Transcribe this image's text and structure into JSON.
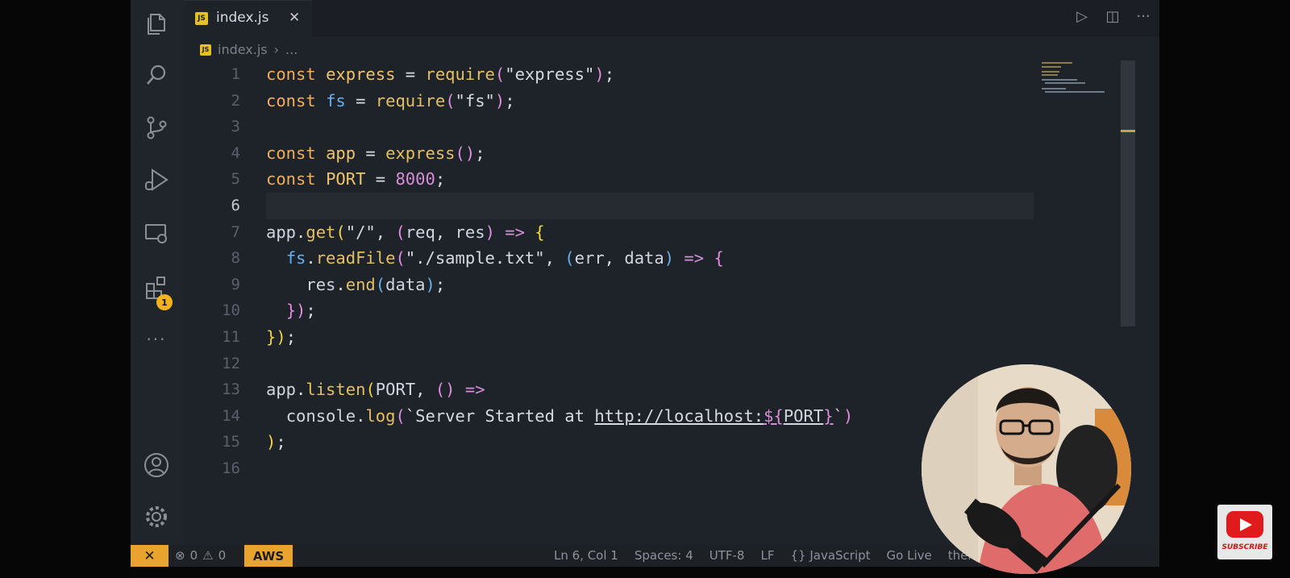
{
  "tab": {
    "icon": "js-file-icon",
    "badge_text": "JS",
    "label": "index.js",
    "close": "✕"
  },
  "breadcrumb": {
    "file": "index.js",
    "sep": "›",
    "more": "..."
  },
  "activity_bar": {
    "items": [
      "explorer-icon",
      "search-icon",
      "source-control-icon",
      "run-debug-icon",
      "remote-explorer-icon",
      "extensions-icon"
    ],
    "extensions_badge": "1",
    "more": "···",
    "bottom": [
      "account-icon",
      "settings-gear-icon"
    ]
  },
  "editor": {
    "active_line": 6,
    "lines": [
      {
        "n": 1,
        "tokens": [
          [
            "kw",
            "const "
          ],
          [
            "vr",
            "express"
          ],
          [
            "op",
            " = "
          ],
          [
            "fn",
            "require"
          ],
          [
            "pu",
            "("
          ],
          [
            "str",
            "\"express\""
          ],
          [
            "pu",
            ")"
          ],
          [
            "op",
            ";"
          ]
        ]
      },
      {
        "n": 2,
        "tokens": [
          [
            "kw",
            "const "
          ],
          [
            "cl",
            "fs"
          ],
          [
            "op",
            " = "
          ],
          [
            "fn",
            "require"
          ],
          [
            "pu",
            "("
          ],
          [
            "str",
            "\"fs\""
          ],
          [
            "pu",
            ")"
          ],
          [
            "op",
            ";"
          ]
        ]
      },
      {
        "n": 3,
        "tokens": []
      },
      {
        "n": 4,
        "tokens": [
          [
            "kw",
            "const "
          ],
          [
            "vr",
            "app"
          ],
          [
            "op",
            " = "
          ],
          [
            "fn",
            "express"
          ],
          [
            "pu",
            "()"
          ],
          [
            "op",
            ";"
          ]
        ]
      },
      {
        "n": 5,
        "tokens": [
          [
            "kw",
            "const "
          ],
          [
            "vr",
            "PORT"
          ],
          [
            "op",
            " = "
          ],
          [
            "nm",
            "8000"
          ],
          [
            "op",
            ";"
          ]
        ]
      },
      {
        "n": 6,
        "tokens": []
      },
      {
        "n": 7,
        "tokens": [
          [
            "pm",
            "app"
          ],
          [
            "op",
            "."
          ],
          [
            "fn",
            "get"
          ],
          [
            "br",
            "("
          ],
          [
            "str",
            "\"/\""
          ],
          [
            "op",
            ", "
          ],
          [
            "pu",
            "("
          ],
          [
            "pm",
            "req"
          ],
          [
            "op",
            ", "
          ],
          [
            "pm",
            "res"
          ],
          [
            "pu",
            ")"
          ],
          [
            "op",
            " "
          ],
          [
            "nm",
            "=>"
          ],
          [
            "op",
            " "
          ],
          [
            "br",
            "{"
          ]
        ]
      },
      {
        "n": 8,
        "tokens": [
          [
            "op",
            "  "
          ],
          [
            "cl",
            "fs"
          ],
          [
            "op",
            "."
          ],
          [
            "fn",
            "readFile"
          ],
          [
            "pu",
            "("
          ],
          [
            "str",
            "\"./sample.txt\""
          ],
          [
            "op",
            ", "
          ],
          [
            "cl",
            "("
          ],
          [
            "pm",
            "err"
          ],
          [
            "op",
            ", "
          ],
          [
            "pm",
            "data"
          ],
          [
            "cl",
            ")"
          ],
          [
            "op",
            " "
          ],
          [
            "nm",
            "=>"
          ],
          [
            "op",
            " "
          ],
          [
            "pu",
            "{"
          ]
        ]
      },
      {
        "n": 9,
        "tokens": [
          [
            "op",
            "    "
          ],
          [
            "pm",
            "res"
          ],
          [
            "op",
            "."
          ],
          [
            "fn",
            "end"
          ],
          [
            "cl",
            "("
          ],
          [
            "pm",
            "data"
          ],
          [
            "cl",
            ")"
          ],
          [
            "op",
            ";"
          ]
        ]
      },
      {
        "n": 10,
        "tokens": [
          [
            "op",
            "  "
          ],
          [
            "pu",
            "})"
          ],
          [
            "op",
            ";"
          ]
        ]
      },
      {
        "n": 11,
        "tokens": [
          [
            "br",
            "})"
          ],
          [
            "op",
            ";"
          ]
        ]
      },
      {
        "n": 12,
        "tokens": []
      },
      {
        "n": 13,
        "tokens": [
          [
            "pm",
            "app"
          ],
          [
            "op",
            "."
          ],
          [
            "fn",
            "listen"
          ],
          [
            "br",
            "("
          ],
          [
            "pm",
            "PORT"
          ],
          [
            "op",
            ", "
          ],
          [
            "pu",
            "()"
          ],
          [
            "op",
            " "
          ],
          [
            "nm",
            "=>"
          ]
        ]
      },
      {
        "n": 14,
        "tokens": [
          [
            "op",
            "  "
          ],
          [
            "pm",
            "console"
          ],
          [
            "op",
            "."
          ],
          [
            "fn",
            "log"
          ],
          [
            "pu",
            "("
          ],
          [
            "str",
            "`Server Started at "
          ],
          [
            "str",
            "http://localhost:"
          ],
          [
            "nm",
            "${"
          ],
          [
            "pm",
            "PORT"
          ],
          [
            "nm",
            "}"
          ],
          [
            "str",
            "`"
          ],
          [
            "pu",
            ")"
          ]
        ]
      },
      {
        "n": 15,
        "tokens": [
          [
            "br",
            ")"
          ],
          [
            "op",
            ";"
          ]
        ]
      },
      {
        "n": 16,
        "tokens": []
      }
    ]
  },
  "statusbar": {
    "remote_icon": "✕",
    "errors": "0",
    "warnings": "0",
    "aws": "AWS",
    "cursor": "Ln 6, Col 1",
    "spaces": "Spaces: 4",
    "encoding": "UTF-8",
    "eol": "LF",
    "language": "{} JavaScript",
    "go_live": "Go Live",
    "prettier": "ther"
  },
  "overlay": {
    "subscribe": "SUBSCRIBE"
  },
  "colors": {
    "accent": "#e8a42c",
    "editor_bg": "#1e2229",
    "keyword": "#f1ad5c",
    "number": "#d68ed8"
  }
}
